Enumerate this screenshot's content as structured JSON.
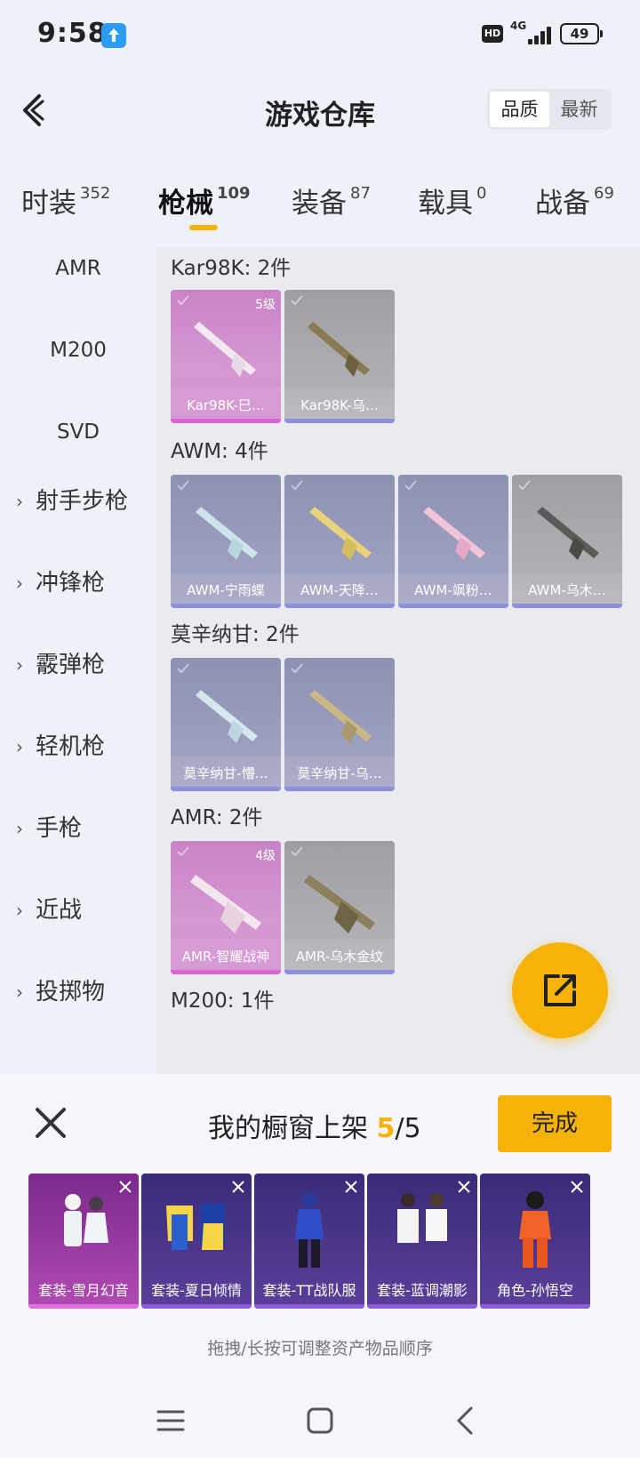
{
  "status": {
    "time": "9:58",
    "network": "4G",
    "hd": "HD",
    "battery": "49"
  },
  "header": {
    "title": "游戏仓库",
    "sort_quality": "品质",
    "sort_latest": "最新"
  },
  "tabs": [
    {
      "label": "时装",
      "count": "352"
    },
    {
      "label": "枪械",
      "count": "109"
    },
    {
      "label": "装备",
      "count": "87"
    },
    {
      "label": "载具",
      "count": "0"
    },
    {
      "label": "战备",
      "count": "69"
    }
  ],
  "sidebar": {
    "sub_items": [
      "AMR",
      "M200",
      "SVD"
    ],
    "groups": [
      "射手步枪",
      "冲锋枪",
      "霰弹枪",
      "轻机枪",
      "手枪",
      "近战",
      "投掷物"
    ]
  },
  "groups": [
    {
      "title": "Kar98K: 2件",
      "items": [
        {
          "name": "Kar98K-巳…",
          "level": "5级"
        },
        {
          "name": "Kar98K-乌…",
          "level": ""
        }
      ]
    },
    {
      "title": "AWM: 4件",
      "items": [
        {
          "name": "AWM-宁雨蝶",
          "level": ""
        },
        {
          "name": "AWM-天降…",
          "level": ""
        },
        {
          "name": "AWM-飒粉…",
          "level": ""
        },
        {
          "name": "AWM-乌木…",
          "level": ""
        }
      ]
    },
    {
      "title": "莫辛纳甘: 2件",
      "items": [
        {
          "name": "莫辛纳甘-懵…",
          "level": ""
        },
        {
          "name": "莫辛纳甘-乌…",
          "level": ""
        }
      ]
    },
    {
      "title": "AMR: 2件",
      "items": [
        {
          "name": "AMR-智耀战神",
          "level": "4级"
        },
        {
          "name": "AMR-乌木金纹",
          "level": ""
        }
      ]
    },
    {
      "title": "M200: 1件",
      "items": []
    }
  ],
  "shelf": {
    "title_prefix": "我的橱窗上架 ",
    "count_current": "5",
    "count_sep_total": "/5",
    "done_label": "完成",
    "hint": "拖拽/长按可调整资产物品顺序",
    "items": [
      {
        "name": "套装-雪月幻音"
      },
      {
        "name": "套装-夏日倾情"
      },
      {
        "name": "套装-TT战队服"
      },
      {
        "name": "套装-蓝调潮影"
      },
      {
        "name": "角色-孙悟空"
      }
    ]
  },
  "colors": {
    "accent": "#f5b30a",
    "pink_rarity": "#d697d3",
    "purple_rarity": "#8c91dc"
  }
}
